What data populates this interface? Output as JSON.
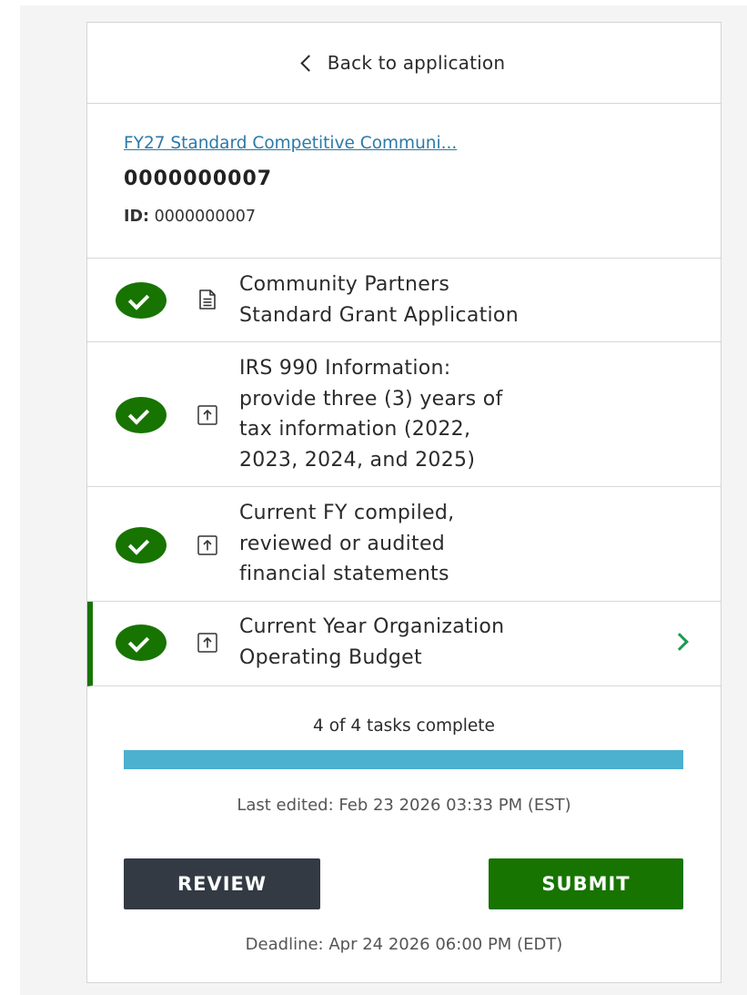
{
  "back_link": {
    "label": "Back to application",
    "icon": "chevron-left-icon"
  },
  "application": {
    "program_name": "FY27 Standard Competitive Communi...",
    "number": "0000000007",
    "id_label": "ID:",
    "id_value": "0000000007"
  },
  "tasks": [
    {
      "label_lines": [
        "Community Partners",
        "Standard Grant Application"
      ],
      "status": "complete",
      "type_icon": "document-icon"
    },
    {
      "label_lines": [
        "IRS 990 Information:",
        "provide three (3) years of",
        "tax information (2022,",
        "2023, 2024, and 2025)"
      ],
      "status": "complete",
      "type_icon": "upload-icon"
    },
    {
      "label_lines": [
        "Current FY compiled,",
        "reviewed or audited",
        "financial statements"
      ],
      "status": "complete",
      "type_icon": "upload-icon"
    },
    {
      "label_lines": [
        "Current Year Organization",
        "Operating Budget"
      ],
      "status": "complete",
      "type_icon": "upload-icon",
      "active": true
    }
  ],
  "progress": {
    "text": "4 of 4 tasks complete",
    "completed": 4,
    "total": 4,
    "fraction": 1.0
  },
  "last_edited": "Last edited: Feb 23 2026 03:33 PM (EST)",
  "buttons": {
    "review": "REVIEW",
    "submit": "SUBMIT"
  },
  "deadline": "Deadline: Apr 24 2026 06:00 PM (EDT)",
  "colors": {
    "complete_green": "#177400",
    "progress_blue": "#4cb0cf",
    "review_button": "#333a44",
    "link_blue": "#2b7aa8",
    "chevron_green": "#1a9a55"
  }
}
